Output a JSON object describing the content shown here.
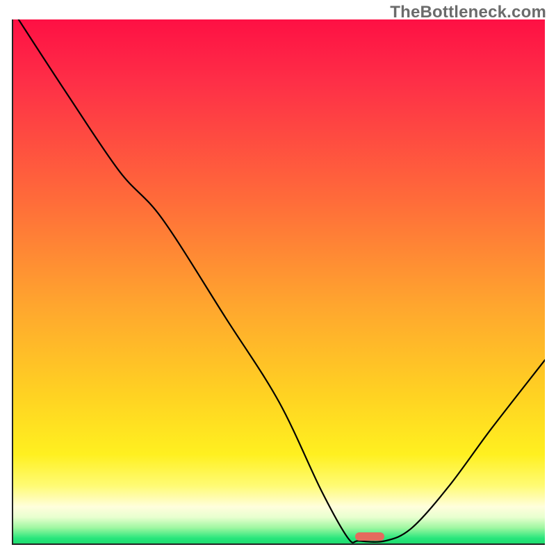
{
  "watermark_text": "TheBottleneck.com",
  "colors": {
    "axis": "#222222",
    "curve": "#000000",
    "notch": "#e46a5e",
    "grad_stops": [
      "#fe1044",
      "#fe2f47",
      "#ff6a3a",
      "#ffa72e",
      "#ffd322",
      "#fff020",
      "#fffb75",
      "#fffedc",
      "#e8ffcf",
      "#9ff7a1",
      "#28e67c",
      "#1fdc6e"
    ]
  },
  "chart_data": {
    "type": "line",
    "title": "",
    "xlabel": "",
    "ylabel": "",
    "xlim": [
      0,
      100
    ],
    "ylim": [
      0,
      100
    ],
    "grid": false,
    "series": [
      {
        "name": "bottleneck-curve",
        "x": [
          1,
          10,
          20,
          28,
          40,
          50,
          58,
          63,
          65,
          70,
          75,
          82,
          90,
          100
        ],
        "y": [
          100,
          86,
          71,
          62,
          43,
          27,
          10,
          1,
          0.5,
          0.5,
          3,
          11,
          22,
          35
        ]
      }
    ],
    "annotations": [
      {
        "name": "optimal-marker",
        "x": 67,
        "y": 0.5,
        "shape": "pill",
        "color": "#e46a5e"
      }
    ]
  }
}
